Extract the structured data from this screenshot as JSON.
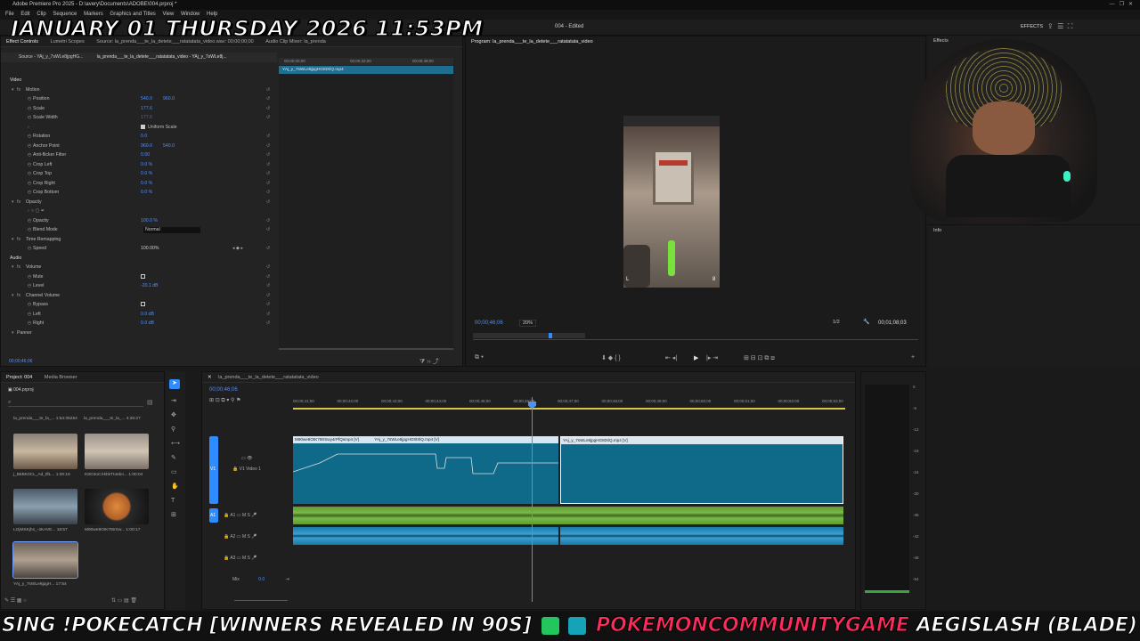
{
  "app": {
    "title": "Adobe Premiere Pro 2025 - D:\\avery\\Documents\\ADOBE\\004.prproj *",
    "document_title": "004 - Edited",
    "menu": [
      "File",
      "Edit",
      "Clip",
      "Sequence",
      "Markers",
      "Graphics and Titles",
      "View",
      "Window",
      "Help"
    ],
    "effects_label": "EFFECTS"
  },
  "overlay": {
    "date_text": "JANUARY 01 THURSDAY 2026 11:53PM",
    "ticker_prefix": "SING !POKECATCH [WINNERS REVEALED IN 90S]",
    "ticker_brand": "POKEMONCOMMUNITYGAME",
    "ticker_suffix": "AEGISLASH (BLADE) ESCAPED. NO ONE CAUGHT IT."
  },
  "source_panel": {
    "tabs": [
      "Effect Controls",
      "Lumetri Scopes",
      "Source: la_prenda___te_la_detete___ratatatata_video.wav: 00;00;00;00",
      "Audio Clip Mixer: la_prenda"
    ],
    "subtabs": [
      "Source - YAj_y_7sWLe8jpgHG...",
      "la_prenda___te_la_detete___ratatatata_video - YAj_y_7sWLe8j..."
    ],
    "clip_name": "YAj_y_7sWLe8jpgHG8tXlQ.mp4",
    "ruler_times": [
      "00;00;00;00",
      "00;00;32;00",
      "00;00;48;00"
    ],
    "timecode": "00;00;46;06",
    "rows": [
      {
        "label": "Video",
        "indent": 0
      },
      {
        "label": "Motion",
        "indent": 1,
        "fx": true
      },
      {
        "label": "Position",
        "indent": 2,
        "value": "540.0",
        "value2": "960.0"
      },
      {
        "label": "Scale",
        "indent": 2,
        "value": "177.6"
      },
      {
        "label": "Scale Width",
        "indent": 2,
        "value": "177.6",
        "dim": true
      },
      {
        "label": "",
        "indent": 2,
        "checkbox": "Uniform Scale"
      },
      {
        "label": "Rotation",
        "indent": 2,
        "value": "0.0"
      },
      {
        "label": "Anchor Point",
        "indent": 2,
        "value": "960.0",
        "value2": "540.0"
      },
      {
        "label": "Anti-flicker Filter",
        "indent": 2,
        "value": "0.00"
      },
      {
        "label": "Crop Left",
        "indent": 2,
        "value": "0.0 %"
      },
      {
        "label": "Crop Top",
        "indent": 2,
        "value": "0.0 %"
      },
      {
        "label": "Crop Right",
        "indent": 2,
        "value": "0.0 %"
      },
      {
        "label": "Crop Bottom",
        "indent": 2,
        "value": "0.0 %"
      },
      {
        "label": "Opacity",
        "indent": 1,
        "fx": true
      },
      {
        "label": "",
        "indent": 2,
        "shapes": true
      },
      {
        "label": "Opacity",
        "indent": 2,
        "value": "100.0 %"
      },
      {
        "label": "Blend Mode",
        "indent": 2,
        "select": "Normal"
      },
      {
        "label": "Time Remapping",
        "indent": 1,
        "fx": true
      },
      {
        "label": "Speed",
        "indent": 2,
        "value": "100.00%",
        "white": true
      },
      {
        "label": "Audio",
        "indent": 0
      },
      {
        "label": "Volume",
        "indent": 1,
        "fx": true
      },
      {
        "label": "Mute",
        "indent": 2,
        "box": true
      },
      {
        "label": "Level",
        "indent": 2,
        "value": "-20.1 dB"
      },
      {
        "label": "Channel Volume",
        "indent": 1,
        "fx": true
      },
      {
        "label": "Bypass",
        "indent": 2,
        "box": true
      },
      {
        "label": "Left",
        "indent": 2,
        "value": "0.0 dB"
      },
      {
        "label": "Right",
        "indent": 2,
        "value": "0.0 dB"
      },
      {
        "label": "Panner",
        "indent": 1
      }
    ]
  },
  "program_panel": {
    "title": "Program: la_prenda___te_la_detete___ratatatata_video",
    "timecode": "00;00;46;06",
    "zoom": "20%",
    "resolution": "1/2",
    "duration": "00;01;08;03",
    "hud_left": "L",
    "hud_right": "8"
  },
  "project_panel": {
    "tabs": [
      "Project: 004",
      "Media Browser"
    ],
    "project_file": "004.prproj",
    "items": [
      {
        "name": "la_prenda___te_la_...",
        "duration": "1:54:35254"
      },
      {
        "name": "la_prenda___te_la_...",
        "duration": "4:26:27"
      },
      {
        "name": "j_B6BK0CL_Ad_tlfL...",
        "duration": "1:00:16"
      },
      {
        "name": "K8O3oCXkbkTt4ebn...",
        "duration": "1:00:04"
      },
      {
        "name": "LOjMSKjhs_-4KAVE...",
        "duration": "18:57"
      },
      {
        "name": "M90we8OtK7t8rSw...",
        "duration": "1:00:17"
      },
      {
        "name": "YAj_y_7sWLe8jpgH...",
        "duration": "17:54"
      }
    ]
  },
  "timeline": {
    "tab": "la_prenda___te_la_detete___ratatatata_video",
    "timecode": "00;00;46;06",
    "ruler": [
      "00;00;41;00",
      "00;00;42;00",
      "00;00;43;00",
      "00;00;44;00",
      "00;00;45;00",
      "00;00;46;00",
      "00;00;47;00",
      "00;00;48;00",
      "00;00;49;00",
      "00;00;50;00",
      "00;00;51;00",
      "00;00;52;00",
      "00;00;53;00"
    ],
    "clips": [
      {
        "name": "M90we8OtK7t8rSwy4rPfQsmp4 [V]"
      },
      {
        "name": "YAj_y_7sWLe8jpgHG8tXlQ.mp4 [V]"
      },
      {
        "name": "YAj_y_7sWLe8jpgHG8tXlQ.mp4 [V]"
      }
    ],
    "tracks": {
      "v1": "V1",
      "v1_name": "Video 1",
      "a1": "A1",
      "a2": "A2",
      "a3": "A3",
      "mix": "Mix",
      "mix_val": "0.0"
    },
    "meter_scale": [
      "0",
      "-6",
      "-12",
      "-18",
      "-24",
      "-30",
      "-36",
      "-42",
      "-48",
      "-54"
    ]
  },
  "panels": {
    "effects_title": "Effects",
    "info_title": "Info"
  },
  "colors": {
    "accent": "#2d8cff",
    "clip_teal": "#0f6a8a",
    "audio_green": "#5e9c2c",
    "audio_blue": "#1b78a8"
  }
}
